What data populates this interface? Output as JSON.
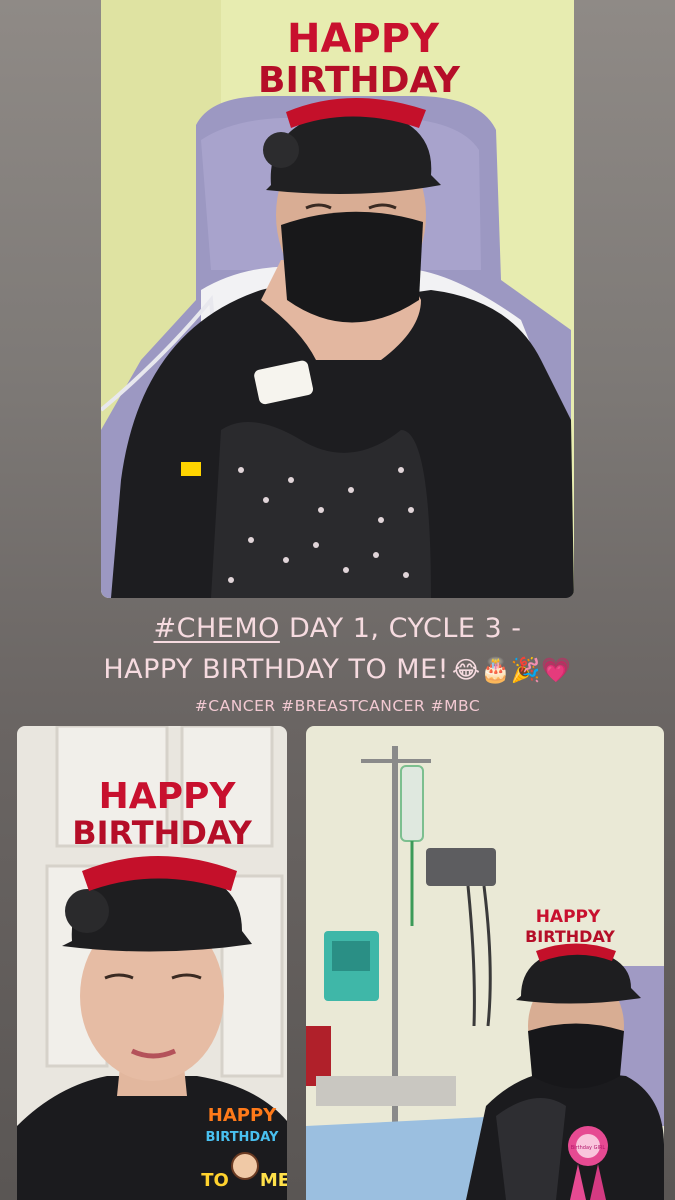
{
  "story": {
    "caption": {
      "tag": "#CHEMO",
      "line1_rest": " DAY 1, CYCLE 3 -",
      "line2": "HAPPY BIRTHDAY TO ME!",
      "emoji": "😂🎂🎉💗"
    },
    "hashtags": "#CANCER #BREASTCANCER #MBC"
  },
  "photos": {
    "top": {
      "tiara_line1": "HAPPY",
      "tiara_line2": "BIRTHDAY"
    },
    "bottom_left": {
      "tiara_line1": "HAPPY",
      "tiara_line2": "BIRTHDAY",
      "sticker_line1": "HAPPY",
      "sticker_line2": "BIRTHDAY",
      "sticker_to": "TO",
      "sticker_me": "ME"
    },
    "bottom_right": {
      "tiara_line1": "HAPPY",
      "tiara_line2": "BIRTHDAY",
      "badge_text": "Birthday GIRL"
    }
  },
  "colors": {
    "caption_text": "#f6dbe0",
    "tiara_red": "#c4102a",
    "wall_yellow": "#eef0b8",
    "chair_lavender": "#9b96bf"
  }
}
